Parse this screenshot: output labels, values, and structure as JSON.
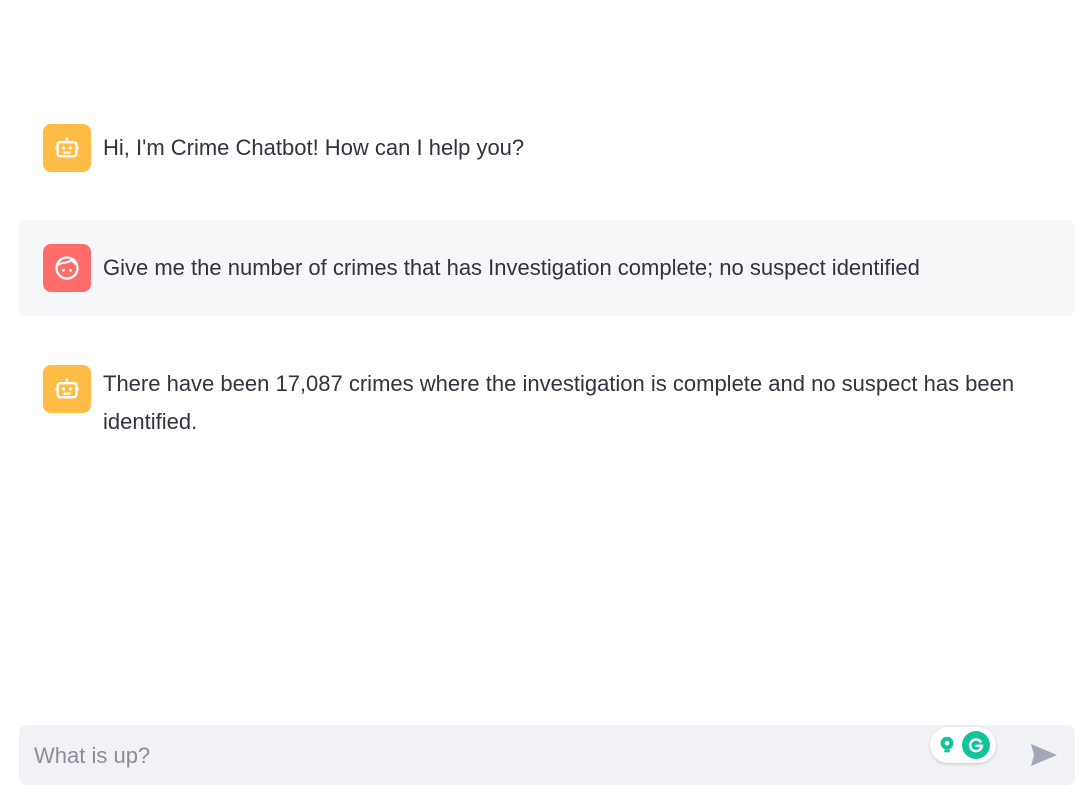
{
  "messages": [
    {
      "role": "assistant",
      "avatar_icon": "robot-icon",
      "text": "Hi, I'm Crime Chatbot! How can I help you?"
    },
    {
      "role": "user",
      "avatar_icon": "user-face-icon",
      "text": "Give me the number of crimes that has Investigation complete; no suspect identified"
    },
    {
      "role": "assistant",
      "avatar_icon": "robot-icon",
      "text": "There have been 17,087 crimes where the investigation is complete and no suspect has been identified."
    }
  ],
  "chat_input": {
    "placeholder": "What is up?",
    "value": ""
  },
  "icons": {
    "send": "send-icon",
    "extension_bulb": "lightbulb-icon",
    "extension_grammarly": "grammarly-icon"
  },
  "colors": {
    "bot_avatar_bg": "#ffbd45",
    "user_avatar_bg": "#ff6c6c",
    "user_message_bg": "#f6f7f9",
    "input_bg": "#f0f2f6",
    "text": "#31333f",
    "grammarly": "#15c39a"
  }
}
